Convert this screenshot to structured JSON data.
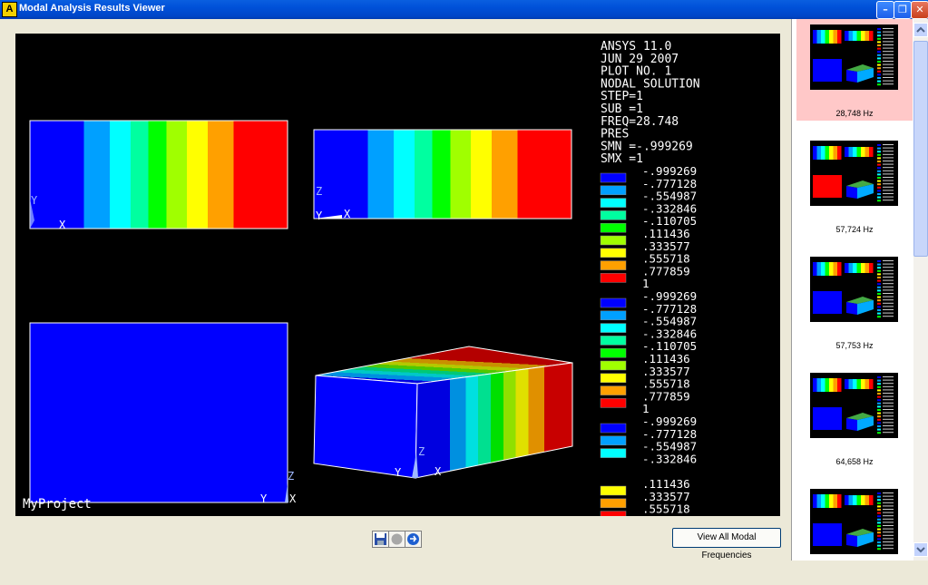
{
  "window": {
    "title": "Modal Analysis Results Viewer",
    "icon_letter": "A",
    "controls": [
      "minimize-icon",
      "maximize-icon",
      "close-icon"
    ]
  },
  "plot_info": {
    "lines": [
      "ANSYS 11.0",
      "JUN 29 2007",
      "PLOT NO.   1",
      "NODAL SOLUTION",
      "STEP=1",
      "SUB =1",
      "FREQ=28.748",
      "PRES",
      "SMN =-.999269",
      "SMX =1"
    ],
    "project_label": "MyProject"
  },
  "legend": {
    "values": [
      "-.999269",
      "-.777128",
      "-.554987",
      "-.332846",
      "-.110705",
      ".111436",
      ".333577",
      ".555718",
      ".777859",
      "1"
    ],
    "colors": [
      "#0000FF",
      "#00A0FF",
      "#00FFFF",
      "#00FFA0",
      "#00FF00",
      "#A0FF00",
      "#FFFF00",
      "#FFA000",
      "#FF0000"
    ],
    "partial_colors": [
      "#0000FF",
      "#00A0FF",
      "#00FFFF",
      "",
      "",
      "#FFFF00",
      "#FFA000",
      "#FF0000"
    ]
  },
  "axes": {
    "view1": [
      "Y",
      "X"
    ],
    "view2": [
      "Z",
      "Y",
      "X"
    ],
    "view3": [
      "Z",
      "Y",
      "X"
    ],
    "view4": [
      "Z",
      "Y",
      "X"
    ]
  },
  "toolbar": {
    "view_all_label": "View All Modal Frequencies",
    "icons": [
      "save-icon",
      "record-icon",
      "refresh-icon"
    ]
  },
  "thumbnails": [
    {
      "label": "28,748 Hz",
      "selected": true
    },
    {
      "label": "57,724 Hz",
      "selected": false
    },
    {
      "label": "57,753 Hz",
      "selected": false
    },
    {
      "label": "64,658 Hz",
      "selected": false
    },
    {
      "label": "",
      "selected": false
    }
  ]
}
